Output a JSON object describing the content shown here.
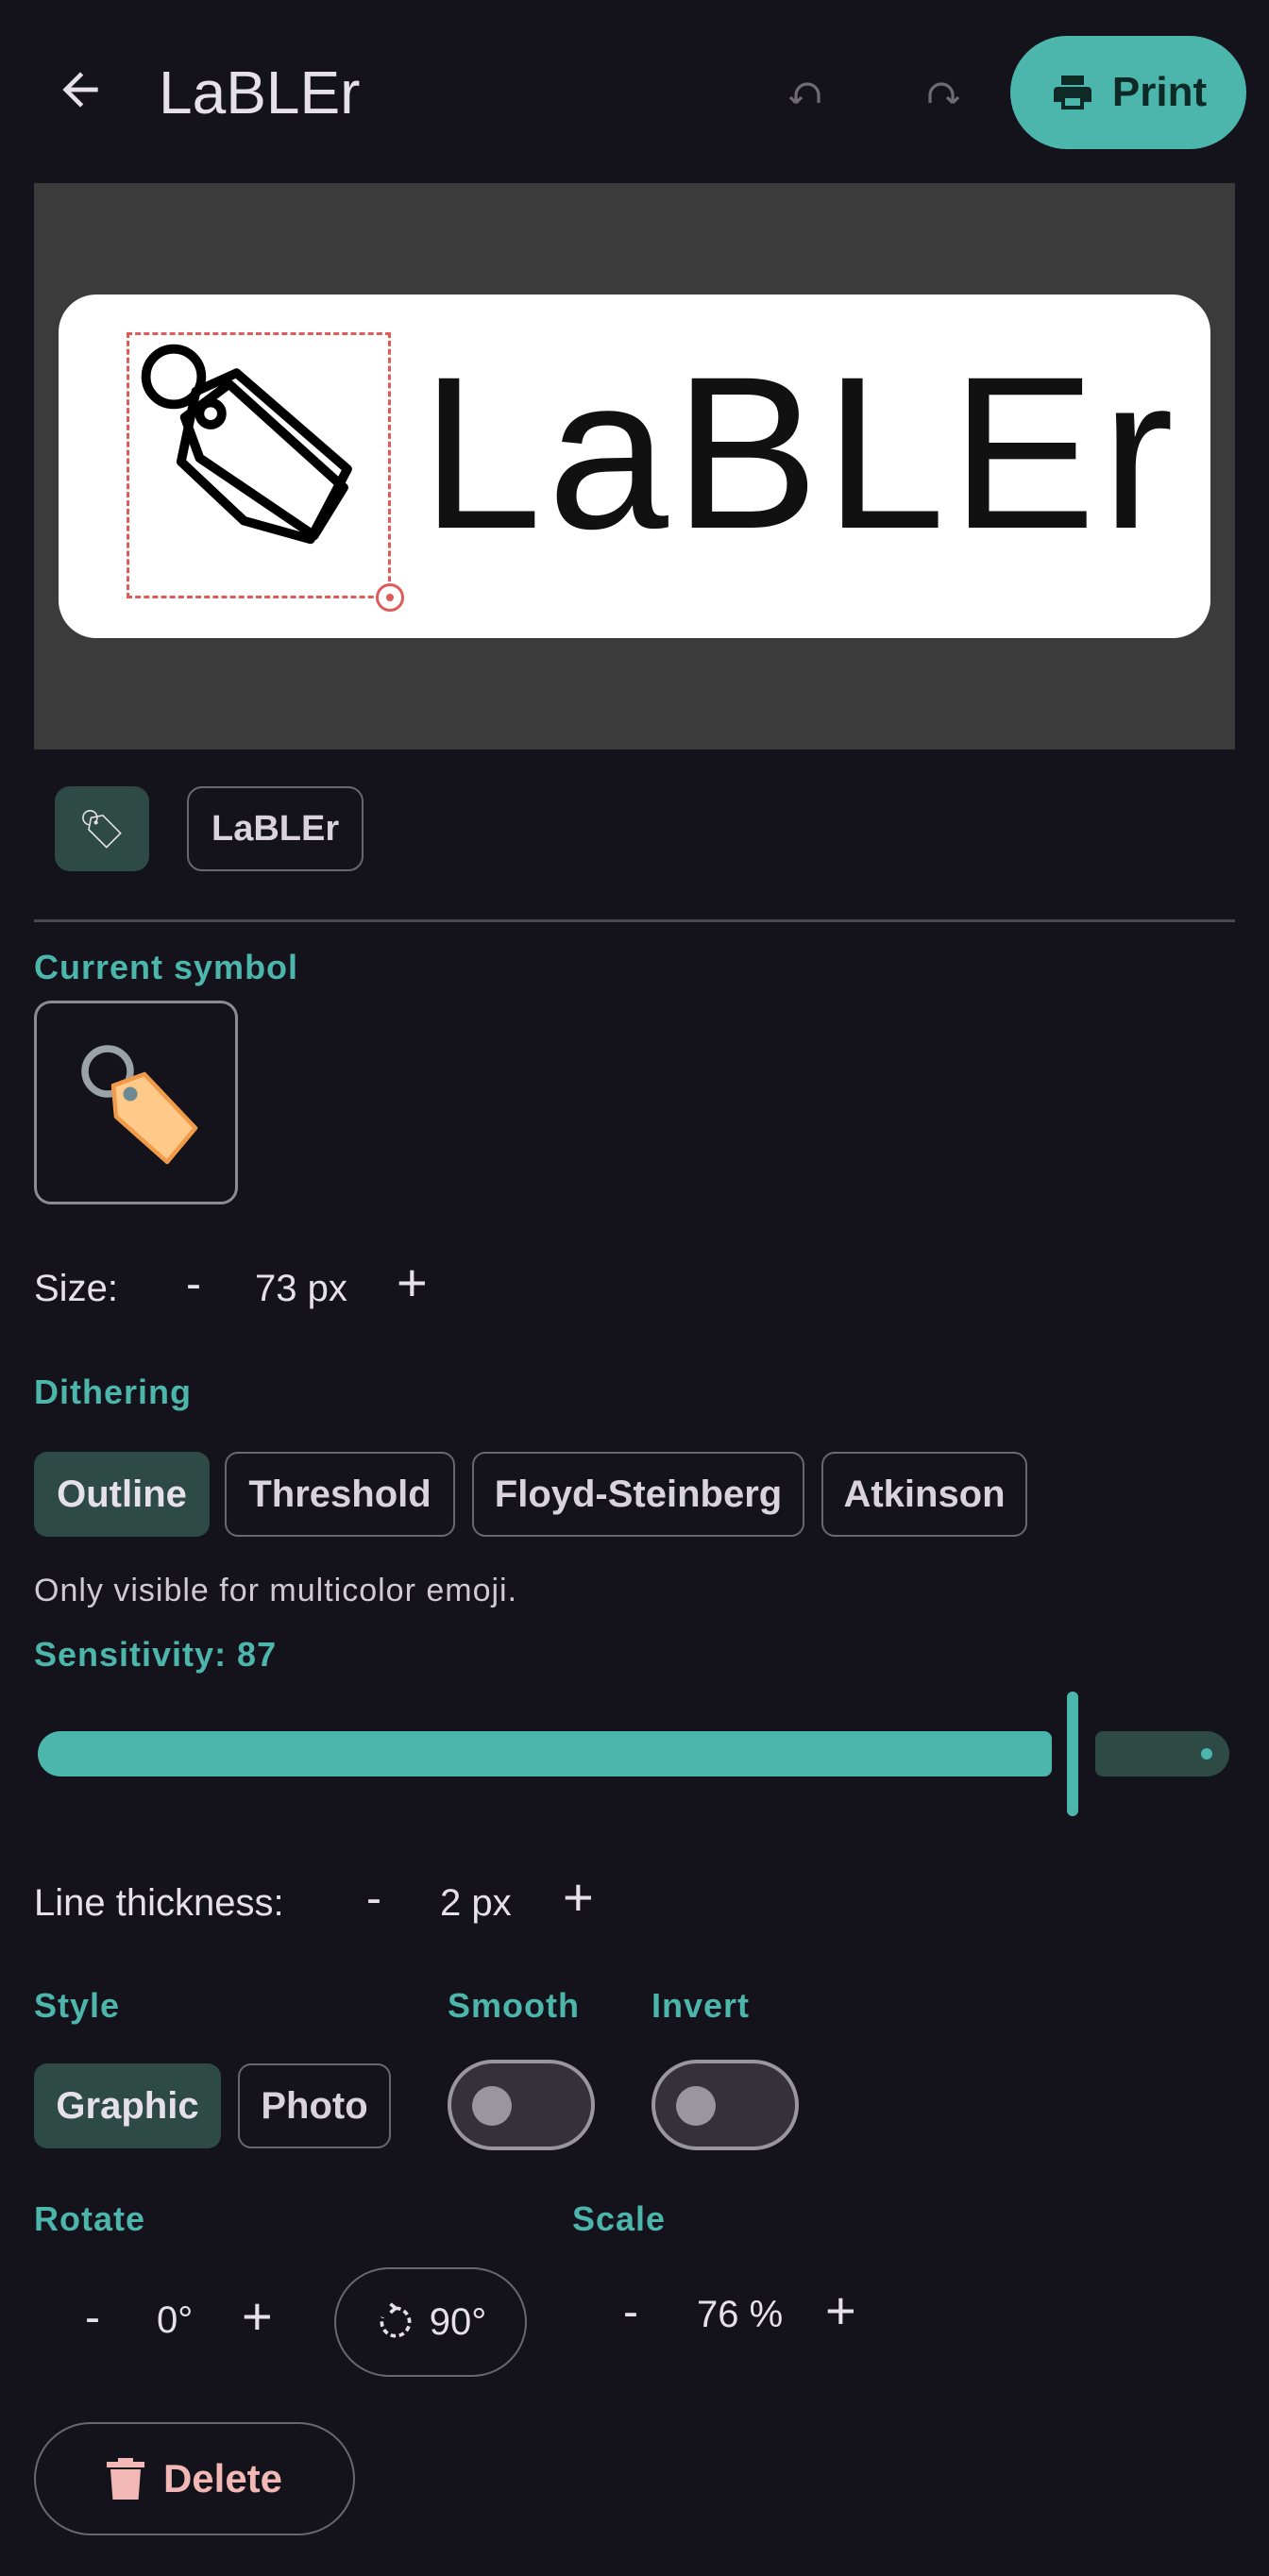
{
  "header": {
    "title": "LaBLEr",
    "print_label": "Print"
  },
  "label": {
    "text": "LaBLEr"
  },
  "elements": {
    "text_chip": "LaBLEr"
  },
  "symbol": {
    "current_label": "Current symbol",
    "size_label": "Size:",
    "size_minus": "-",
    "size_value": "73 px",
    "size_plus": "+"
  },
  "dithering": {
    "label": "Dithering",
    "options": [
      "Outline",
      "Threshold",
      "Floyd-Steinberg",
      "Atkinson"
    ],
    "selected": "Outline",
    "hint": "Only visible for multicolor emoji."
  },
  "sensitivity": {
    "label": "Sensitivity: 87",
    "value": 87
  },
  "line_thickness": {
    "label": "Line thickness:",
    "minus": "-",
    "value": "2 px",
    "plus": "+"
  },
  "style": {
    "label": "Style",
    "options": [
      "Graphic",
      "Photo"
    ],
    "selected": "Graphic"
  },
  "smooth": {
    "label": "Smooth",
    "on": false
  },
  "invert": {
    "label": "Invert",
    "on": false
  },
  "rotate": {
    "label": "Rotate",
    "minus": "-",
    "value": "0°",
    "plus": "+",
    "rotate90_label": "90°"
  },
  "scale": {
    "label": "Scale",
    "minus": "-",
    "value": "76 %",
    "plus": "+"
  },
  "actions": {
    "delete_label": "Delete"
  },
  "colors": {
    "accent": "#4db6ac",
    "background": "#14121a",
    "selected_chip": "#2e4a45",
    "delete_text": "#f2b8b5"
  }
}
